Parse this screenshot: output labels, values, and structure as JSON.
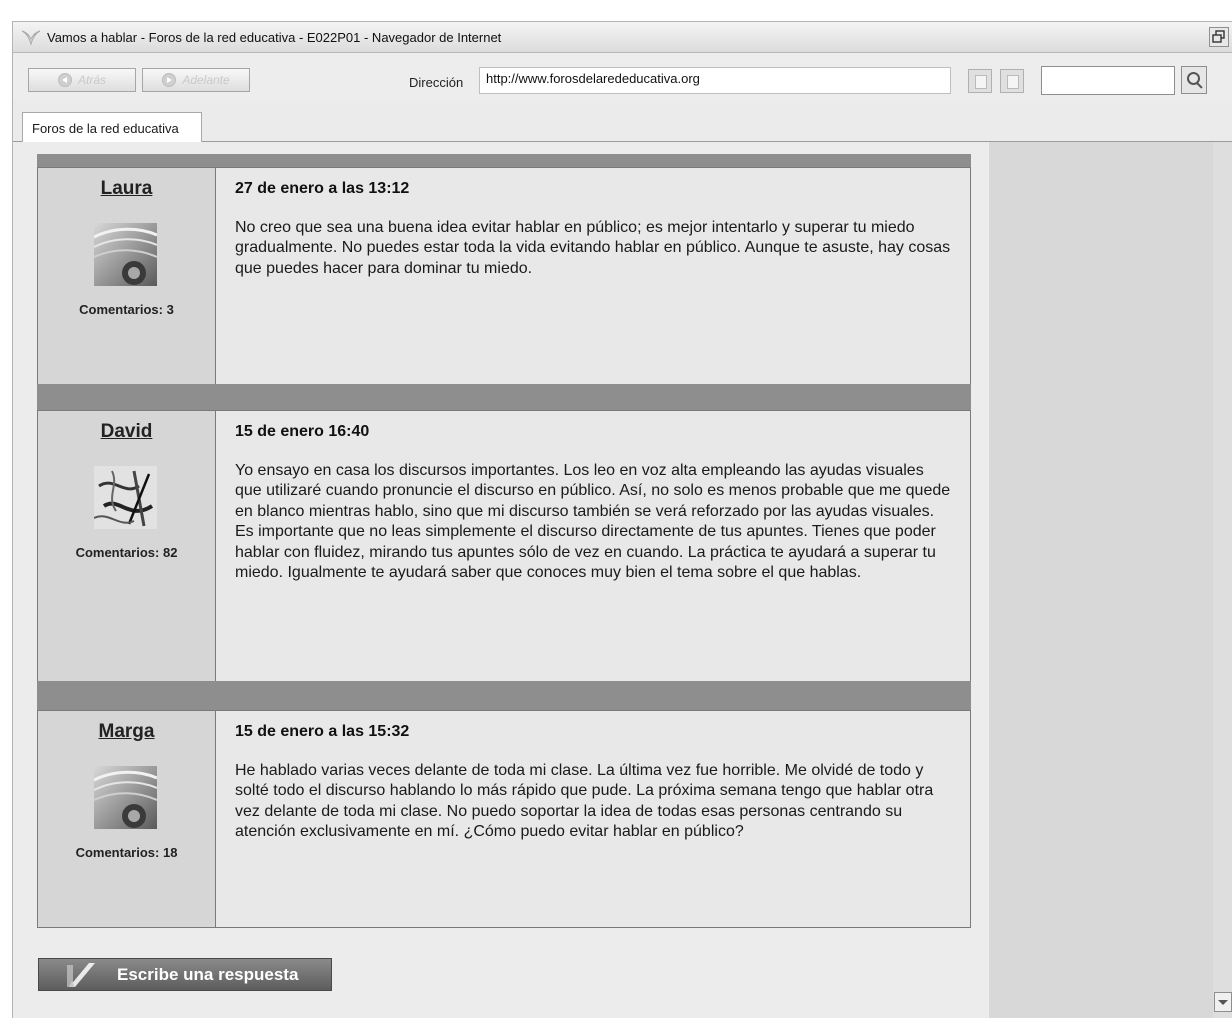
{
  "window": {
    "title": "Vamos a hablar - Foros de la red educativa - E022P01 - Navegador de Internet"
  },
  "toolbar": {
    "back_label": "Atrás",
    "forward_label": "Adelante",
    "address_label": "Dirección",
    "address_value": "http://www.forosdelarededucativa.org",
    "search_value": ""
  },
  "tabs": [
    {
      "label": "Foros de la red educativa"
    }
  ],
  "posts": [
    {
      "author": "Laura",
      "comments": "Comentarios: 3",
      "date": "27 de enero a las 13:12",
      "text": "No creo que sea una buena idea evitar hablar en público; es mejor intentarlo y superar tu miedo gradualmente. No puedes estar toda la vida evitando hablar en público. Aunque te asuste, hay cosas que puedes hacer para dominar tu miedo."
    },
    {
      "author": "David",
      "comments": "Comentarios: 82",
      "date": "15 de enero 16:40",
      "text": "Yo ensayo en casa los discursos importantes. Los leo en voz alta empleando las ayudas visuales que utilizaré cuando pronuncie el discurso en público. Así, no solo es menos probable que me quede en blanco mientras hablo, sino que mi discurso también se verá reforzado por las ayudas visuales. Es importante que no leas simplemente el discurso directamente de tus apuntes. Tienes que poder hablar con fluidez, mirando tus apuntes sólo de vez en cuando. La práctica te ayudará a superar tu miedo. Igualmente te ayudará saber que conoces muy bien el tema sobre el que hablas."
    },
    {
      "author": "Marga",
      "comments": "Comentarios: 18",
      "date": "15 de enero a las 15:32",
      "text": "He hablado varias veces delante de toda mi clase. La última vez fue horrible. Me olvidé de todo y solté todo el discurso hablando lo más rápido que pude. La próxima semana tengo que hablar otra vez delante de toda mi clase. No puedo soportar la idea de todas esas personas centrando su atención exclusivamente en mí. ¿Cómo puedo evitar hablar en público?"
    }
  ],
  "reply_button": {
    "label": "Escribe una respuesta"
  }
}
